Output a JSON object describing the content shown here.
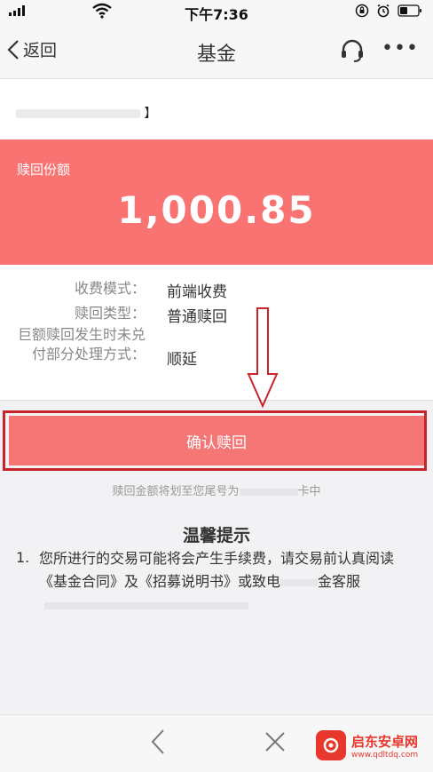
{
  "status_bar": {
    "time": "下午7:36"
  },
  "nav": {
    "back_label": "返回",
    "title": "基金",
    "more_label": "•••"
  },
  "fund": {
    "name_suffix": "】"
  },
  "banner": {
    "label": "赎回份额",
    "amount": "1,000.85"
  },
  "details": [
    {
      "label": "收费模式：",
      "value": "前端收费"
    },
    {
      "label": "赎回类型：",
      "value": "普通赎回"
    },
    {
      "label": "巨额赎回发生时未兑付部分处理方式：",
      "value": "顺延"
    }
  ],
  "confirm": {
    "label": "确认赎回"
  },
  "hint": {
    "prefix": "赎回金额将划至您尾号为",
    "suffix": "卡中"
  },
  "tips": {
    "title": "温馨提示",
    "number": "1.",
    "text": "您所进行的交易可能将会产生手续费，请交易前认真阅读《基金合同》及《招募说明书》或致电",
    "text_end": "金客服"
  },
  "watermark": {
    "main": "启东安卓网",
    "sub": "www.qdltdq.com"
  },
  "colors": {
    "banner": "#f87371",
    "confirm": "#f47675",
    "annotation": "#c8232d"
  }
}
